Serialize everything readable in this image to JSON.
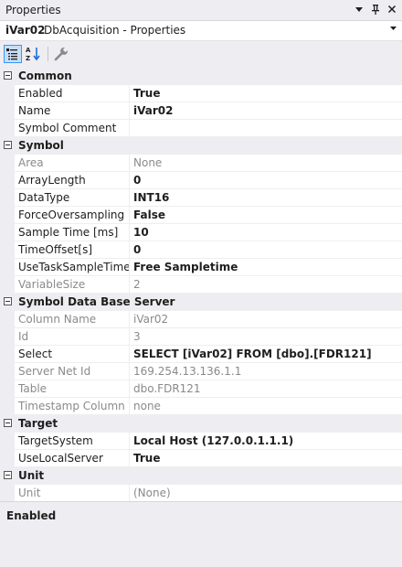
{
  "window": {
    "title": "Properties"
  },
  "object_selector": {
    "name": "iVar02",
    "type": "DbAcquisition - Properties"
  },
  "toolbar": {
    "buttons": [
      {
        "icon": "categorized-icon",
        "active": true
      },
      {
        "icon": "alphabetical-sort-icon",
        "active": false
      },
      {
        "icon": "wrench-icon",
        "active": false
      }
    ]
  },
  "grid": [
    {
      "kind": "category",
      "label": "Common"
    },
    {
      "kind": "prop",
      "name": "Enabled",
      "value": "True",
      "bold": true,
      "readonly": false
    },
    {
      "kind": "prop",
      "name": "Name",
      "value": "iVar02",
      "bold": true,
      "readonly": false
    },
    {
      "kind": "prop",
      "name": "Symbol Comment",
      "value": "",
      "bold": false,
      "readonly": false
    },
    {
      "kind": "category",
      "label": "Symbol"
    },
    {
      "kind": "prop",
      "name": "Area",
      "value": "None",
      "bold": false,
      "readonly": true
    },
    {
      "kind": "prop",
      "name": "ArrayLength",
      "value": "0",
      "bold": true,
      "readonly": false
    },
    {
      "kind": "prop",
      "name": "DataType",
      "value": "INT16",
      "bold": true,
      "readonly": false
    },
    {
      "kind": "prop",
      "name": "ForceOversampling",
      "value": "False",
      "bold": true,
      "readonly": false
    },
    {
      "kind": "prop",
      "name": "Sample Time [ms]",
      "value": "10",
      "bold": true,
      "readonly": false
    },
    {
      "kind": "prop",
      "name": "TimeOffset[s]",
      "value": "0",
      "bold": true,
      "readonly": false
    },
    {
      "kind": "prop",
      "name": "UseTaskSampleTime",
      "value": "Free Sampletime",
      "bold": true,
      "readonly": false
    },
    {
      "kind": "prop",
      "name": "VariableSize",
      "value": "2",
      "bold": false,
      "readonly": true
    },
    {
      "kind": "category",
      "label": "Symbol Data Base Server"
    },
    {
      "kind": "prop",
      "name": "Column Name",
      "value": "iVar02",
      "bold": false,
      "readonly": true
    },
    {
      "kind": "prop",
      "name": "Id",
      "value": "3",
      "bold": false,
      "readonly": true
    },
    {
      "kind": "prop",
      "name": "Select",
      "value": "SELECT [iVar02] FROM [dbo].[FDR121]",
      "bold": true,
      "readonly": false
    },
    {
      "kind": "prop",
      "name": "Server Net Id",
      "value": "169.254.13.136.1.1",
      "bold": false,
      "readonly": true
    },
    {
      "kind": "prop",
      "name": "Table",
      "value": "dbo.FDR121",
      "bold": false,
      "readonly": true
    },
    {
      "kind": "prop",
      "name": "Timestamp Column",
      "value": "none",
      "bold": false,
      "readonly": true
    },
    {
      "kind": "category",
      "label": "Target"
    },
    {
      "kind": "prop",
      "name": "TargetSystem",
      "value": "Local Host (127.0.0.1.1.1)",
      "bold": true,
      "readonly": false
    },
    {
      "kind": "prop",
      "name": "UseLocalServer",
      "value": "True",
      "bold": true,
      "readonly": false
    },
    {
      "kind": "category",
      "label": "Unit"
    },
    {
      "kind": "prop",
      "name": "Unit",
      "value": "(None)",
      "bold": false,
      "readonly": true
    }
  ],
  "description": {
    "title": "Enabled"
  }
}
